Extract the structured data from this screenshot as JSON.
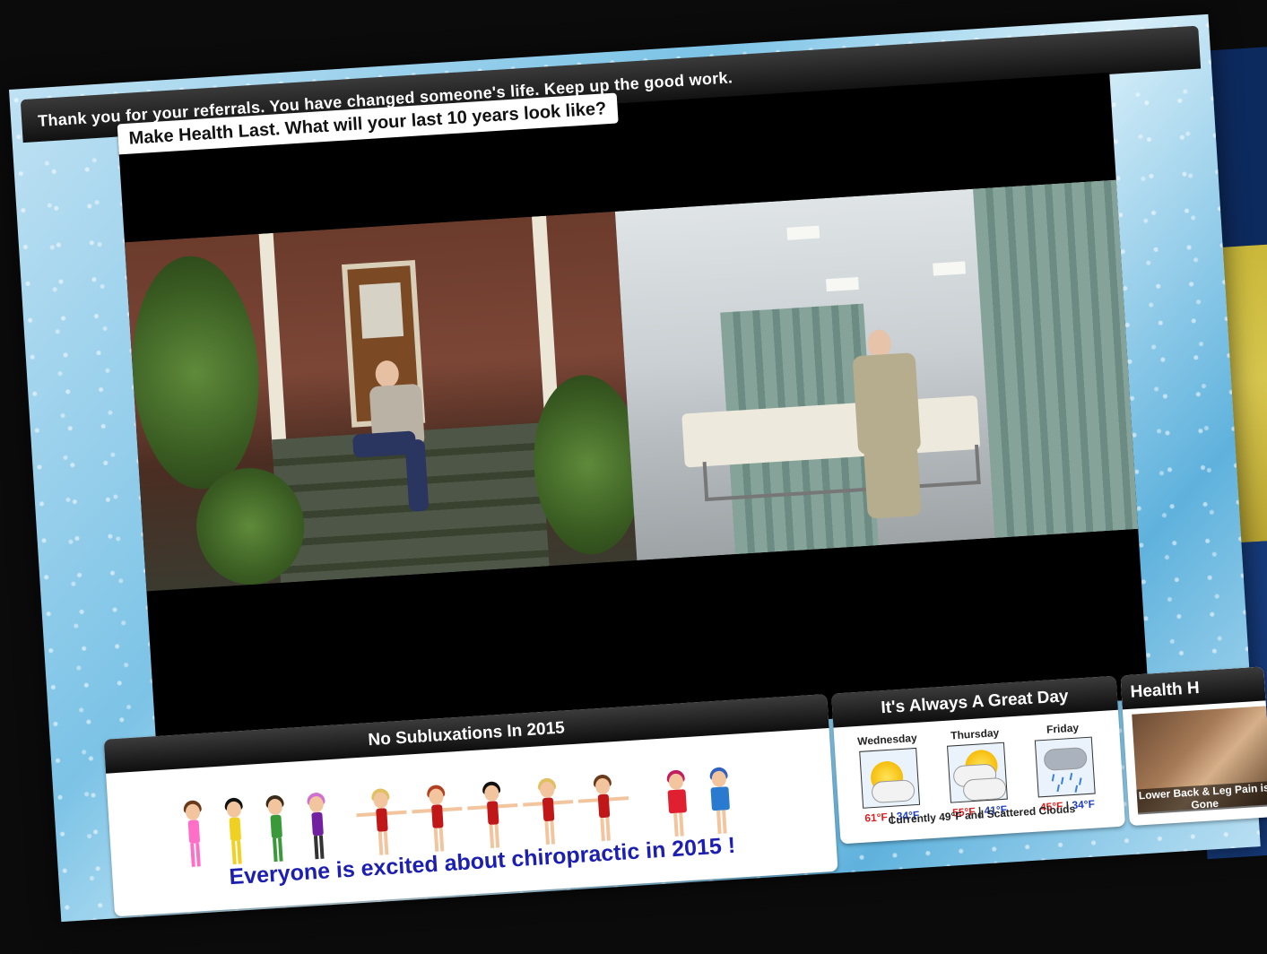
{
  "banner": {
    "message": "Thank you for your referrals. You have changed someone's life. Keep up the good work."
  },
  "video": {
    "title": "Make Health Last. What will your last 10 years look like?"
  },
  "subluxation_widget": {
    "title": "No Subluxations In 2015",
    "caption": "Everyone is excited about chiropractic in 2015 !"
  },
  "weather_widget": {
    "title": "It's Always A Great Day",
    "days": [
      {
        "name": "Wednesday",
        "icon": "partly-sunny-icon",
        "high": "61°F",
        "low": "34°F"
      },
      {
        "name": "Thursday",
        "icon": "partly-cloudy-icon",
        "high": "55°F",
        "low": "41°F"
      },
      {
        "name": "Friday",
        "icon": "rain-icon",
        "high": "45°F",
        "low": "34°F"
      }
    ],
    "separator": "|",
    "current": "Currently 49°F and Scattered Clouds"
  },
  "health_widget": {
    "title": "Health H",
    "caption": "Lower Back & Leg Pain is Gone"
  },
  "colors": {
    "caption_blue": "#1c1fb0",
    "high_red": "#e02020",
    "low_blue": "#2040c0"
  }
}
